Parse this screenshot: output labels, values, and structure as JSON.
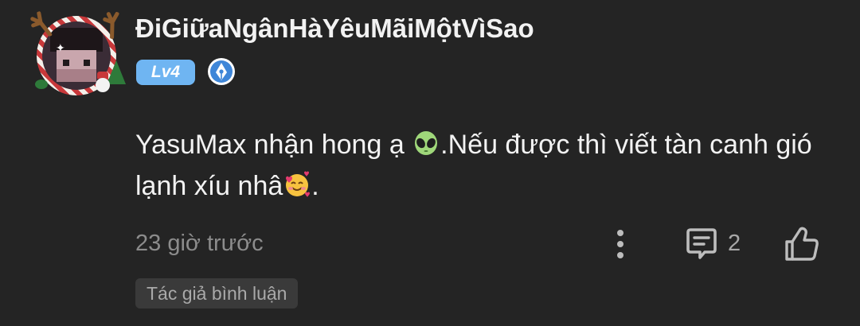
{
  "user": {
    "name": "ĐiGiữaNgânHàYêuMãiMộtVìSao",
    "level": "Lv4",
    "level_color": "#6fb5f2",
    "badge_icon": "pen-nib-icon"
  },
  "comment": {
    "text_part1": "YasuMax nhận hong ạ ",
    "emoji1": "alien-emoji",
    "text_part2": ".Nếu được thì viết tàn canh gió lạnh xíu nhâ",
    "emoji2": "smiling-face-with-hearts-emoji",
    "text_part3": "."
  },
  "footer": {
    "timestamp": "23 giờ trước",
    "reply_count": "2",
    "author_tag": "Tác giả bình luận"
  }
}
